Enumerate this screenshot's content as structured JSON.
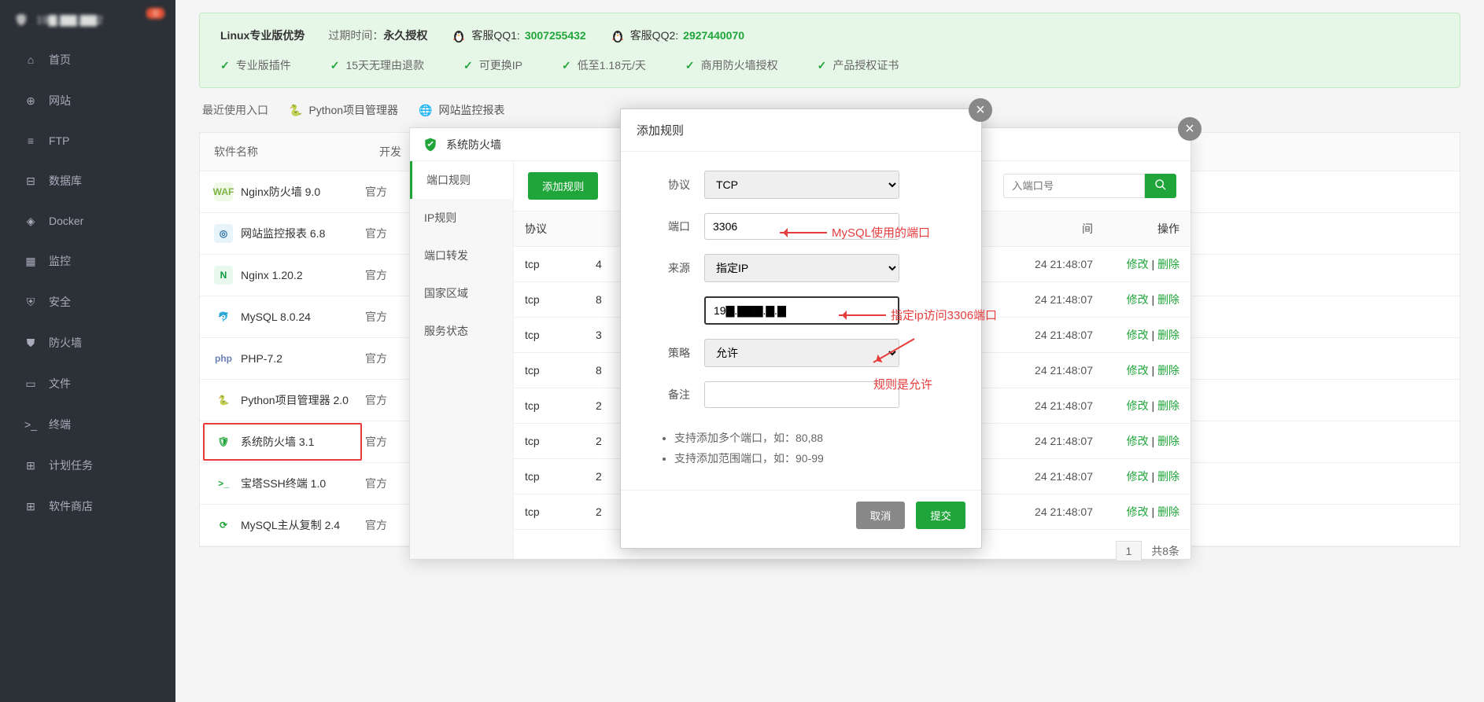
{
  "header": {
    "ip_masked": "19▇.▇▇.▇▇2",
    "alert_count": "0"
  },
  "sidebar": {
    "items": [
      {
        "label": "首页"
      },
      {
        "label": "网站"
      },
      {
        "label": "FTP"
      },
      {
        "label": "数据库"
      },
      {
        "label": "Docker"
      },
      {
        "label": "监控"
      },
      {
        "label": "安全"
      },
      {
        "label": "防火墙"
      },
      {
        "label": "文件"
      },
      {
        "label": "终端"
      },
      {
        "label": "计划任务"
      },
      {
        "label": "软件商店"
      }
    ]
  },
  "banner": {
    "title": "Linux专业版优势",
    "expire_label": "过期时间：",
    "expire_value": "永久授权",
    "qq1_label": "客服QQ1:",
    "qq1_num": "3007255432",
    "qq2_label": "客服QQ2:",
    "qq2_num": "2927440070",
    "features": [
      "专业版插件",
      "15天无理由退款",
      "可更换IP",
      "低至1.18元/天",
      "商用防火墙授权",
      "产品授权证书"
    ]
  },
  "recent": {
    "label": "最近使用入口",
    "plugins": [
      "Python项目管理器",
      "网站监控报表"
    ]
  },
  "soft_table": {
    "header": {
      "name": "软件名称",
      "dev": "开发"
    },
    "rows": [
      {
        "icon_bg": "#f0f8e8",
        "icon_fg": "#7cb342",
        "icon_txt": "WAF",
        "name": "Nginx防火墙 9.0",
        "dev": "官方"
      },
      {
        "icon_bg": "#e8f4fb",
        "icon_fg": "#2c6ea7",
        "icon_txt": "◎",
        "name": "网站监控报表 6.8",
        "dev": "官方"
      },
      {
        "icon_bg": "#e8f8ec",
        "icon_fg": "#0a9c3a",
        "icon_txt": "N",
        "name": "Nginx 1.20.2",
        "dev": "官方"
      },
      {
        "icon_bg": "#fff",
        "icon_fg": "#1a6aa6",
        "icon_txt": "🐬",
        "name": "MySQL 8.0.24",
        "dev": "官方"
      },
      {
        "icon_bg": "#fff",
        "icon_fg": "#6a7fb5",
        "icon_txt": "php",
        "name": "PHP-7.2",
        "dev": "官方"
      },
      {
        "icon_bg": "#fff",
        "icon_fg": "#c79a2a",
        "icon_txt": "🐍",
        "name": "Python项目管理器 2.0",
        "dev": "官方"
      },
      {
        "icon_bg": "#fff",
        "icon_fg": "#20a53a",
        "icon_txt": "🛡",
        "name": "系统防火墙 3.1",
        "dev": "官方",
        "selected": true
      },
      {
        "icon_bg": "#fff",
        "icon_fg": "#20a53a",
        "icon_txt": ">_",
        "name": "宝塔SSH终端 1.0",
        "dev": "官方"
      },
      {
        "icon_bg": "#fff",
        "icon_fg": "#20a53a",
        "icon_txt": "⟳",
        "name": "MySQL主从复制 2.4",
        "dev": "官方"
      }
    ]
  },
  "modal1": {
    "title": "系统防火墙",
    "sidebar": [
      "端口规则",
      "IP规则",
      "端口转发",
      "国家区域",
      "服务状态"
    ],
    "add_btn": "添加规则",
    "search_placeholder": "入端口号",
    "table": {
      "header": {
        "proto": "协议",
        "op": "操作",
        "time_partial": "间"
      },
      "rows": [
        {
          "proto": "tcp",
          "port": "4",
          "time": "24 21:48:07",
          "edit": "修改",
          "del": "删除"
        },
        {
          "proto": "tcp",
          "port": "8",
          "time": "24 21:48:07",
          "edit": "修改",
          "del": "删除"
        },
        {
          "proto": "tcp",
          "port": "3",
          "time": "24 21:48:07",
          "edit": "修改",
          "del": "删除"
        },
        {
          "proto": "tcp",
          "port": "8",
          "time": "24 21:48:07",
          "edit": "修改",
          "del": "删除"
        },
        {
          "proto": "tcp",
          "port": "2",
          "time": "24 21:48:07",
          "edit": "修改",
          "del": "删除"
        },
        {
          "proto": "tcp",
          "port": "2",
          "time": "24 21:48:07",
          "edit": "修改",
          "del": "删除"
        },
        {
          "proto": "tcp",
          "port": "2",
          "time": "24 21:48:07",
          "edit": "修改",
          "del": "删除"
        },
        {
          "proto": "tcp",
          "port": "2",
          "time": "24 21:48:07",
          "edit": "修改",
          "del": "删除"
        }
      ],
      "pager": {
        "page": "1",
        "total": "共8条"
      }
    }
  },
  "modal2": {
    "title": "添加规则",
    "labels": {
      "proto": "协议",
      "port": "端口",
      "source": "来源",
      "policy": "策略",
      "remark": "备注"
    },
    "values": {
      "proto": "TCP",
      "port": "3306",
      "source": "指定IP",
      "ip": "19▇.▇▇▇.▇.▇",
      "policy": "允许",
      "remark": ""
    },
    "tips": [
      "支持添加多个端口，如：80,88",
      "支持添加范围端口，如：90-99"
    ],
    "cancel": "取消",
    "submit": "提交"
  },
  "annotations": {
    "a1": "MySQL使用的端口",
    "a2": "指定ip访问3306端口",
    "a3": "规则是允许"
  }
}
